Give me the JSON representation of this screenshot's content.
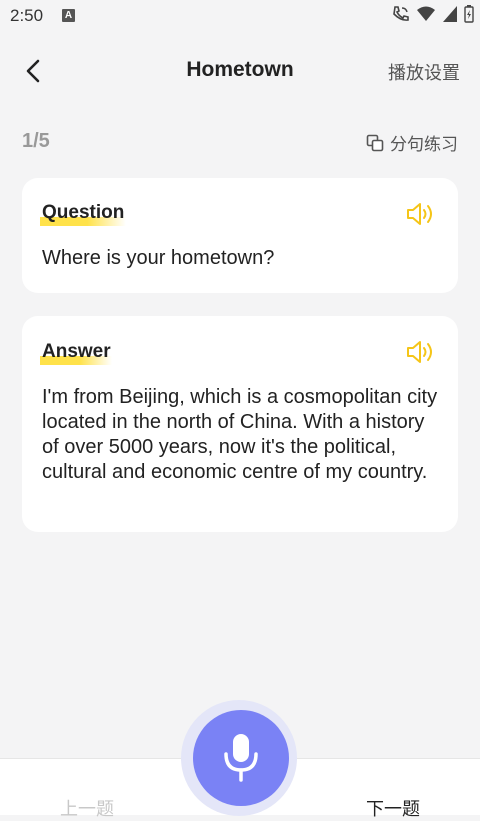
{
  "status_bar": {
    "time": "2:50",
    "notification_icon": "a-icon"
  },
  "header": {
    "title": "Hometown",
    "settings_label": "播放设置"
  },
  "progress": {
    "text": "1/5",
    "split_practice_label": "分句练习"
  },
  "question": {
    "label": "Question",
    "text": "Where is your hometown?"
  },
  "answer": {
    "label": "Answer",
    "text": "I'm from Beijing, which is a cosmopolitan city located in the north of China. With a history of over 5000 years, now it's the political, cultural and economic centre of my country."
  },
  "nav": {
    "prev_label": "上一题",
    "next_label": "下一题"
  },
  "colors": {
    "accent": "#7a82f5",
    "highlight": "#ffe24a",
    "speaker": "#f5c518"
  }
}
